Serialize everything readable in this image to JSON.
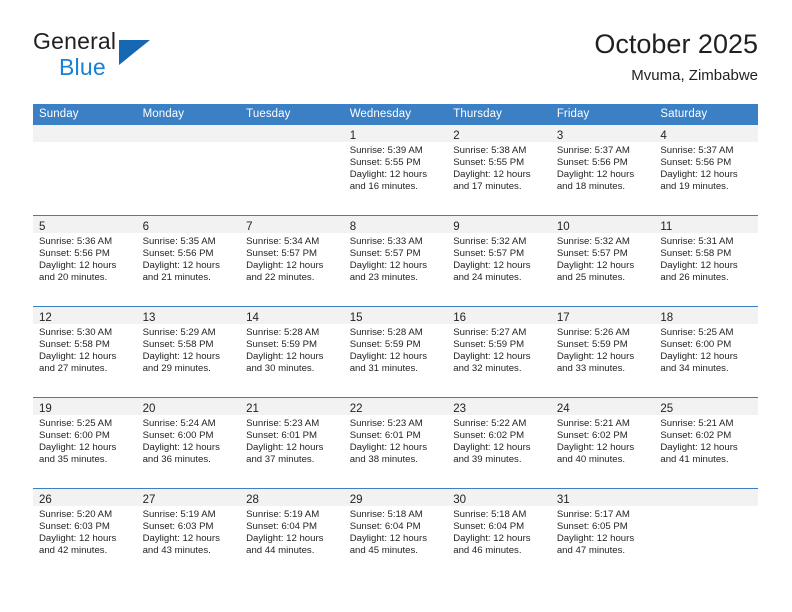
{
  "brand": {
    "name_part1": "General",
    "name_part2": "Blue",
    "logo_icon": "triangle-logo-icon"
  },
  "header": {
    "month_title": "October 2025",
    "location": "Mvuma, Zimbabwe"
  },
  "colors": {
    "header_blue": "#3b7fc4",
    "brand_blue": "#1b7fd4",
    "logo_triangle": "#1668b3",
    "daynum_band": "#f2f2f2",
    "text": "#231f20"
  },
  "weekday_headers": [
    "Sunday",
    "Monday",
    "Tuesday",
    "Wednesday",
    "Thursday",
    "Friday",
    "Saturday"
  ],
  "weeks": [
    [
      {
        "day": "",
        "sunrise": "",
        "sunset": "",
        "daylight_line1": "",
        "daylight_line2": "",
        "empty": true
      },
      {
        "day": "",
        "sunrise": "",
        "sunset": "",
        "daylight_line1": "",
        "daylight_line2": "",
        "empty": true
      },
      {
        "day": "",
        "sunrise": "",
        "sunset": "",
        "daylight_line1": "",
        "daylight_line2": "",
        "empty": true
      },
      {
        "day": "1",
        "sunrise": "Sunrise: 5:39 AM",
        "sunset": "Sunset: 5:55 PM",
        "daylight_line1": "Daylight: 12 hours",
        "daylight_line2": "and 16 minutes."
      },
      {
        "day": "2",
        "sunrise": "Sunrise: 5:38 AM",
        "sunset": "Sunset: 5:55 PM",
        "daylight_line1": "Daylight: 12 hours",
        "daylight_line2": "and 17 minutes."
      },
      {
        "day": "3",
        "sunrise": "Sunrise: 5:37 AM",
        "sunset": "Sunset: 5:56 PM",
        "daylight_line1": "Daylight: 12 hours",
        "daylight_line2": "and 18 minutes."
      },
      {
        "day": "4",
        "sunrise": "Sunrise: 5:37 AM",
        "sunset": "Sunset: 5:56 PM",
        "daylight_line1": "Daylight: 12 hours",
        "daylight_line2": "and 19 minutes."
      }
    ],
    [
      {
        "day": "5",
        "sunrise": "Sunrise: 5:36 AM",
        "sunset": "Sunset: 5:56 PM",
        "daylight_line1": "Daylight: 12 hours",
        "daylight_line2": "and 20 minutes."
      },
      {
        "day": "6",
        "sunrise": "Sunrise: 5:35 AM",
        "sunset": "Sunset: 5:56 PM",
        "daylight_line1": "Daylight: 12 hours",
        "daylight_line2": "and 21 minutes."
      },
      {
        "day": "7",
        "sunrise": "Sunrise: 5:34 AM",
        "sunset": "Sunset: 5:57 PM",
        "daylight_line1": "Daylight: 12 hours",
        "daylight_line2": "and 22 minutes."
      },
      {
        "day": "8",
        "sunrise": "Sunrise: 5:33 AM",
        "sunset": "Sunset: 5:57 PM",
        "daylight_line1": "Daylight: 12 hours",
        "daylight_line2": "and 23 minutes."
      },
      {
        "day": "9",
        "sunrise": "Sunrise: 5:32 AM",
        "sunset": "Sunset: 5:57 PM",
        "daylight_line1": "Daylight: 12 hours",
        "daylight_line2": "and 24 minutes."
      },
      {
        "day": "10",
        "sunrise": "Sunrise: 5:32 AM",
        "sunset": "Sunset: 5:57 PM",
        "daylight_line1": "Daylight: 12 hours",
        "daylight_line2": "and 25 minutes."
      },
      {
        "day": "11",
        "sunrise": "Sunrise: 5:31 AM",
        "sunset": "Sunset: 5:58 PM",
        "daylight_line1": "Daylight: 12 hours",
        "daylight_line2": "and 26 minutes."
      }
    ],
    [
      {
        "day": "12",
        "sunrise": "Sunrise: 5:30 AM",
        "sunset": "Sunset: 5:58 PM",
        "daylight_line1": "Daylight: 12 hours",
        "daylight_line2": "and 27 minutes."
      },
      {
        "day": "13",
        "sunrise": "Sunrise: 5:29 AM",
        "sunset": "Sunset: 5:58 PM",
        "daylight_line1": "Daylight: 12 hours",
        "daylight_line2": "and 29 minutes."
      },
      {
        "day": "14",
        "sunrise": "Sunrise: 5:28 AM",
        "sunset": "Sunset: 5:59 PM",
        "daylight_line1": "Daylight: 12 hours",
        "daylight_line2": "and 30 minutes."
      },
      {
        "day": "15",
        "sunrise": "Sunrise: 5:28 AM",
        "sunset": "Sunset: 5:59 PM",
        "daylight_line1": "Daylight: 12 hours",
        "daylight_line2": "and 31 minutes."
      },
      {
        "day": "16",
        "sunrise": "Sunrise: 5:27 AM",
        "sunset": "Sunset: 5:59 PM",
        "daylight_line1": "Daylight: 12 hours",
        "daylight_line2": "and 32 minutes."
      },
      {
        "day": "17",
        "sunrise": "Sunrise: 5:26 AM",
        "sunset": "Sunset: 5:59 PM",
        "daylight_line1": "Daylight: 12 hours",
        "daylight_line2": "and 33 minutes."
      },
      {
        "day": "18",
        "sunrise": "Sunrise: 5:25 AM",
        "sunset": "Sunset: 6:00 PM",
        "daylight_line1": "Daylight: 12 hours",
        "daylight_line2": "and 34 minutes."
      }
    ],
    [
      {
        "day": "19",
        "sunrise": "Sunrise: 5:25 AM",
        "sunset": "Sunset: 6:00 PM",
        "daylight_line1": "Daylight: 12 hours",
        "daylight_line2": "and 35 minutes."
      },
      {
        "day": "20",
        "sunrise": "Sunrise: 5:24 AM",
        "sunset": "Sunset: 6:00 PM",
        "daylight_line1": "Daylight: 12 hours",
        "daylight_line2": "and 36 minutes."
      },
      {
        "day": "21",
        "sunrise": "Sunrise: 5:23 AM",
        "sunset": "Sunset: 6:01 PM",
        "daylight_line1": "Daylight: 12 hours",
        "daylight_line2": "and 37 minutes."
      },
      {
        "day": "22",
        "sunrise": "Sunrise: 5:23 AM",
        "sunset": "Sunset: 6:01 PM",
        "daylight_line1": "Daylight: 12 hours",
        "daylight_line2": "and 38 minutes."
      },
      {
        "day": "23",
        "sunrise": "Sunrise: 5:22 AM",
        "sunset": "Sunset: 6:02 PM",
        "daylight_line1": "Daylight: 12 hours",
        "daylight_line2": "and 39 minutes."
      },
      {
        "day": "24",
        "sunrise": "Sunrise: 5:21 AM",
        "sunset": "Sunset: 6:02 PM",
        "daylight_line1": "Daylight: 12 hours",
        "daylight_line2": "and 40 minutes."
      },
      {
        "day": "25",
        "sunrise": "Sunrise: 5:21 AM",
        "sunset": "Sunset: 6:02 PM",
        "daylight_line1": "Daylight: 12 hours",
        "daylight_line2": "and 41 minutes."
      }
    ],
    [
      {
        "day": "26",
        "sunrise": "Sunrise: 5:20 AM",
        "sunset": "Sunset: 6:03 PM",
        "daylight_line1": "Daylight: 12 hours",
        "daylight_line2": "and 42 minutes."
      },
      {
        "day": "27",
        "sunrise": "Sunrise: 5:19 AM",
        "sunset": "Sunset: 6:03 PM",
        "daylight_line1": "Daylight: 12 hours",
        "daylight_line2": "and 43 minutes."
      },
      {
        "day": "28",
        "sunrise": "Sunrise: 5:19 AM",
        "sunset": "Sunset: 6:04 PM",
        "daylight_line1": "Daylight: 12 hours",
        "daylight_line2": "and 44 minutes."
      },
      {
        "day": "29",
        "sunrise": "Sunrise: 5:18 AM",
        "sunset": "Sunset: 6:04 PM",
        "daylight_line1": "Daylight: 12 hours",
        "daylight_line2": "and 45 minutes."
      },
      {
        "day": "30",
        "sunrise": "Sunrise: 5:18 AM",
        "sunset": "Sunset: 6:04 PM",
        "daylight_line1": "Daylight: 12 hours",
        "daylight_line2": "and 46 minutes."
      },
      {
        "day": "31",
        "sunrise": "Sunrise: 5:17 AM",
        "sunset": "Sunset: 6:05 PM",
        "daylight_line1": "Daylight: 12 hours",
        "daylight_line2": "and 47 minutes."
      },
      {
        "day": "",
        "sunrise": "",
        "sunset": "",
        "daylight_line1": "",
        "daylight_line2": "",
        "empty": true
      }
    ]
  ]
}
